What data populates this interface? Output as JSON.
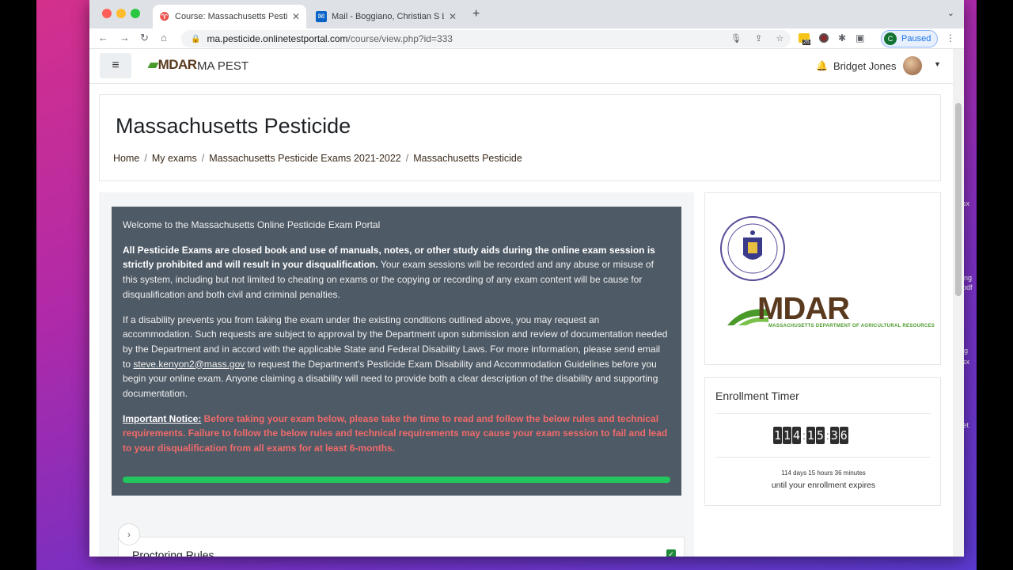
{
  "browser": {
    "tabs": [
      {
        "title": "Course: Massachusetts Pesticide",
        "active": true
      },
      {
        "title": "Mail - Boggiano, Christian S LT",
        "active": false
      }
    ],
    "url_host": "ma.pesticide.onlinetestportal.com",
    "url_path": "/course/view.php?id=333",
    "profile_initial": "C",
    "profile_status": "Paused",
    "ext_badge": "26"
  },
  "site": {
    "brand_logo": "MDAR",
    "brand_name": "MA PEST",
    "user_name": "Bridget Jones"
  },
  "header": {
    "title": "Massachusetts Pesticide",
    "breadcrumbs": [
      "Home",
      "My exams",
      "Massachusetts Pesticide Exams 2021-2022",
      "Massachusetts Pesticide"
    ]
  },
  "welcome": {
    "intro": "Welcome to the Massachusetts Online Pesticide Exam Portal",
    "p1_bold": "All Pesticide Exams are closed book and use of manuals, notes, or other study aids during the online exam session is strictly prohibited and will result in your disqualification.",
    "p1_rest": " Your exam sessions will be recorded and any abuse or misuse of this system, including but not limited to cheating on exams or the copying or recording of any exam content will be cause for disqualification and both civil and criminal penalties.",
    "p2_a": "If a disability prevents you from taking the exam under the existing conditions outlined above, you may request an accommodation. Such requests are subject to approval by the Department upon submission and review of documentation needed by the Department and in accord with the applicable State and Federal Disability Laws. For more information, please send email to ",
    "p2_email": "steve.kenyon2@mass.gov",
    "p2_b": " to request the Department's Pesticide Exam Disability and Accommodation Guidelines before you begin your online exam. Anyone claiming a disability will need to provide both a clear description of the disability and supporting documentation.",
    "notice_label": "Important Notice:",
    "notice_text": " Before taking your exam below, please take the time to read and follow the below rules and technical requirements. Failure to follow the below rules and technical requirements may cause your exam session to fail and lead to your disqualification from all exams for at least 6-months.",
    "progress": 1.0
  },
  "proctoring": {
    "title": "Proctoring Rules"
  },
  "side": {
    "mdar_word": "MDAR",
    "mdar_sub": "MASSACHUSETTS DEPARTMENT OF AGRICULTURAL RESOURCES"
  },
  "timer": {
    "title": "Enrollment Timer",
    "digits": [
      "1",
      "1",
      "4",
      "1",
      "5",
      "3",
      "6"
    ],
    "detail": "114 days 15 hours 36 minutes",
    "expires": "until your enrollment expires"
  },
  "desktop": {
    "labels": [
      "x",
      "lsx",
      "ng",
      "pdf",
      "g",
      "lsx",
      "ket"
    ]
  },
  "colors": {
    "welcome_bg": "#4e5a66",
    "notice_red": "#f06a6a",
    "progress_green": "#22c55e",
    "brand_brown": "#5a3a1e",
    "brand_green": "#4a9a2a"
  }
}
